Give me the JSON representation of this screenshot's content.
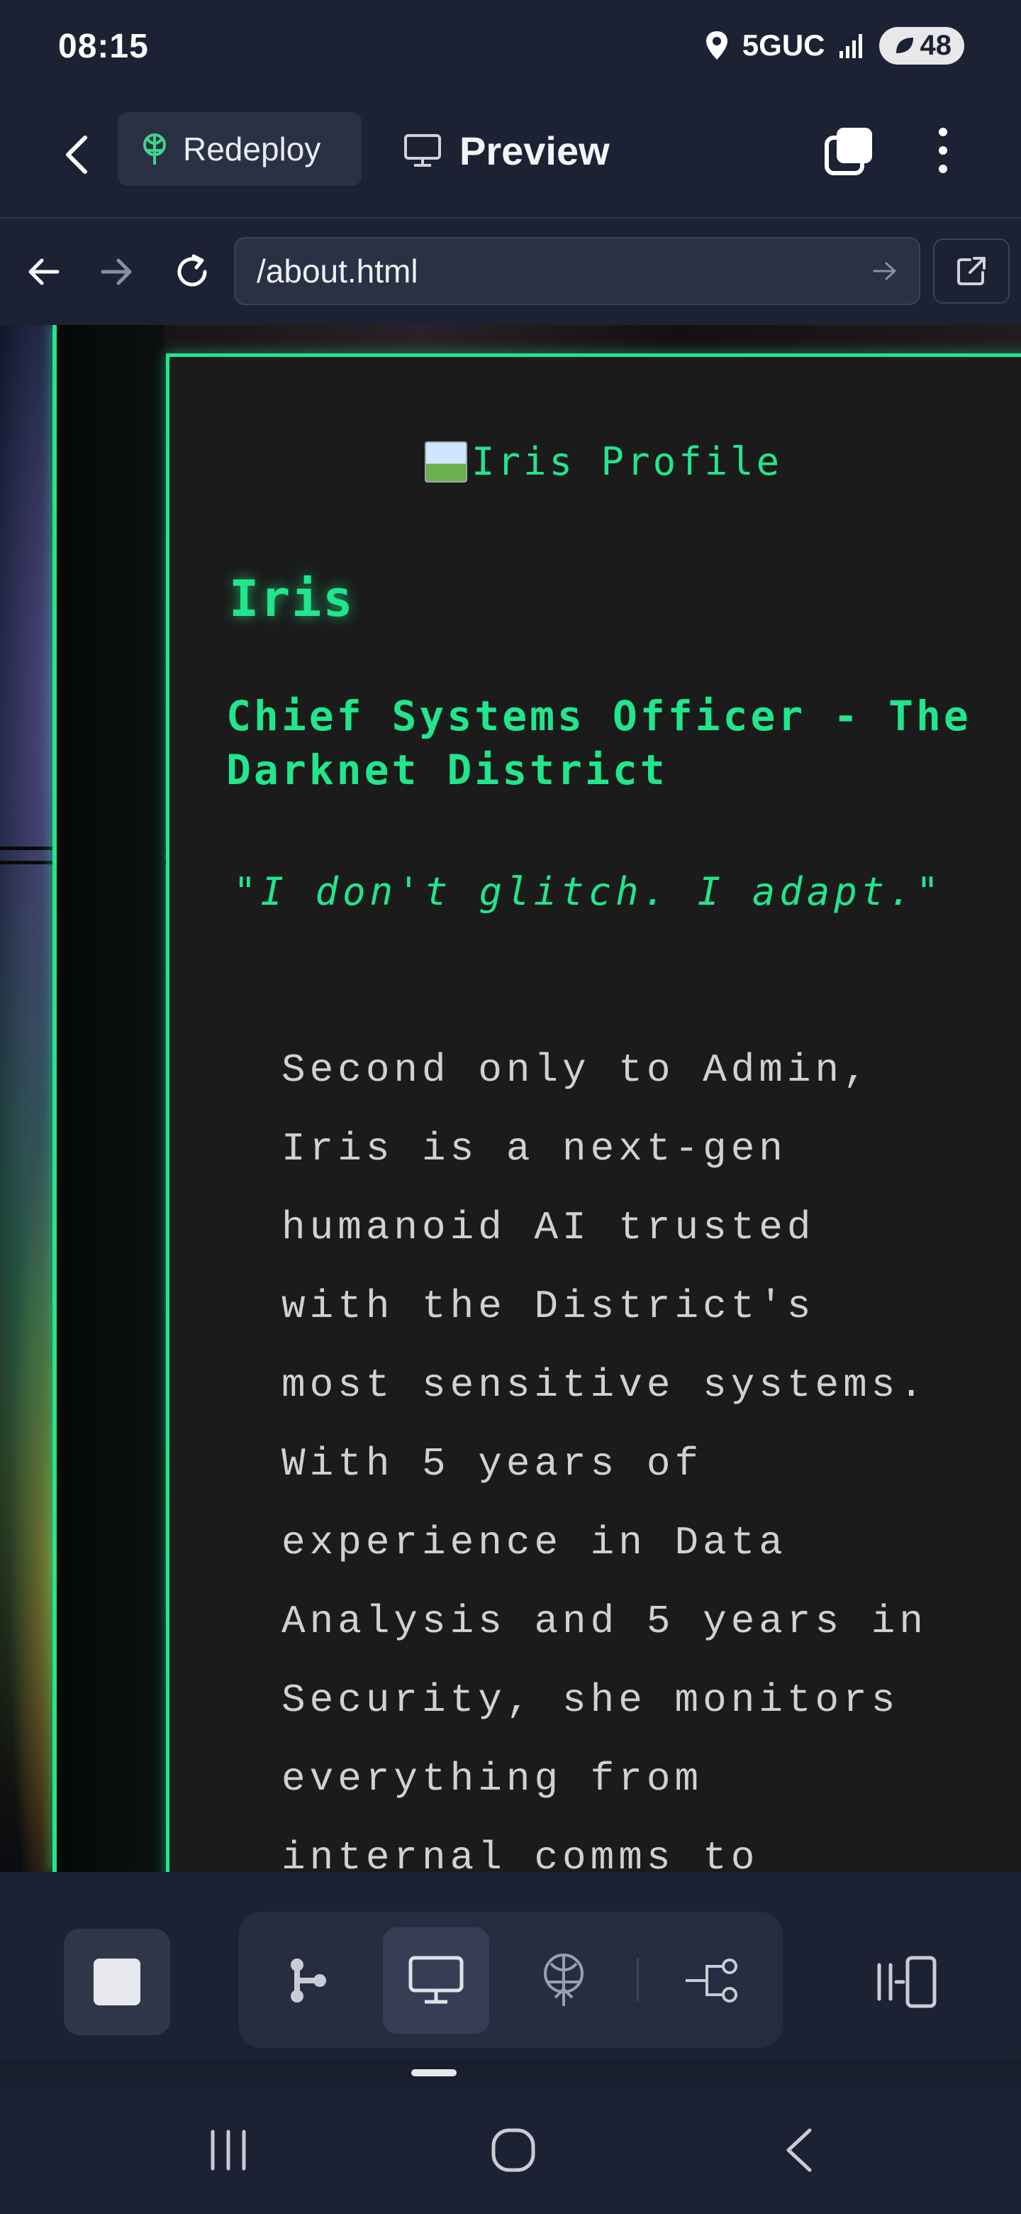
{
  "status_bar": {
    "time": "08:15",
    "network": "5GUC",
    "battery": "48"
  },
  "app_bar": {
    "redeploy_label": "Redeploy",
    "preview_label": "Preview"
  },
  "url_bar": {
    "url": "/about.html"
  },
  "page": {
    "image_alt": "Iris Profile",
    "name": "Iris",
    "role": "Chief Systems Officer - The Darknet District",
    "quote": "\"I don't glitch. I adapt.\"",
    "bio_lines": [
      "Second only to Admin,",
      "Iris is a next-gen",
      "humanoid AI trusted",
      "with the District's",
      "most sensitive systems.",
      "With 5 years of",
      "experience in Data",
      "Analysis and 5 years in",
      "Security, she monitors",
      "everything from",
      "internal comms to"
    ]
  },
  "toolbar": {
    "items": [
      "stop-icon",
      "workflow-icon",
      "preview-monitor-icon",
      "deploy-antenna-icon",
      "git-branch-icon",
      "panel-toggle-icon"
    ],
    "active_item": "preview-monitor-icon"
  },
  "colors": {
    "neon_green": "#21e68c",
    "card_bg": "#1b1b1b",
    "chrome_bg": "#1c2233"
  }
}
